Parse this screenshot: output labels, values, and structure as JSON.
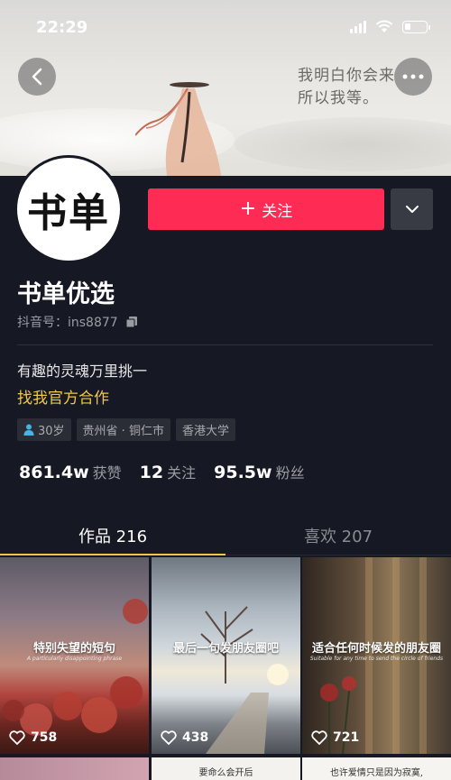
{
  "status_bar": {
    "time": "22:29"
  },
  "banner": {
    "poem_line1": "我明白你会来",
    "poem_line2": "所以我等。"
  },
  "profile": {
    "avatar_text": "书单",
    "name": "书单优选",
    "account_id": "抖音号：ins8877",
    "bio": "有趣的灵魂万里挑一",
    "cooperation_link": "找我官方合作",
    "follow_label": "关注",
    "tags": [
      {
        "icon": "person-icon",
        "label": "30岁"
      },
      {
        "label": "贵州省 · 铜仁市"
      },
      {
        "label": "香港大学"
      }
    ],
    "stats": [
      {
        "value": "861.4w",
        "label": "获赞"
      },
      {
        "value": "12",
        "label": "关注"
      },
      {
        "value": "95.5w",
        "label": "粉丝"
      }
    ]
  },
  "tabs": [
    {
      "label": "作品 216",
      "active": true
    },
    {
      "label": "喜欢 207",
      "active": false
    }
  ],
  "videos": [
    {
      "caption": "特别失望的短句",
      "subtitle": "A particularly disappointing phrase",
      "likes": "758"
    },
    {
      "caption": "最后一句发朋友圈吧",
      "subtitle": "",
      "likes": "438"
    },
    {
      "caption": "适合任何时候发的朋友圈",
      "subtitle": "Suitable for any time to send the circle of friends",
      "likes": "721"
    }
  ],
  "videos_row2": [
    {
      "caption": ""
    },
    {
      "caption": "要命么会开后"
    },
    {
      "caption": "也许爱情只是因为寂寞,"
    }
  ],
  "colors": {
    "accent": "#fe2c55",
    "highlight": "#f2c648",
    "background": "#161823"
  }
}
